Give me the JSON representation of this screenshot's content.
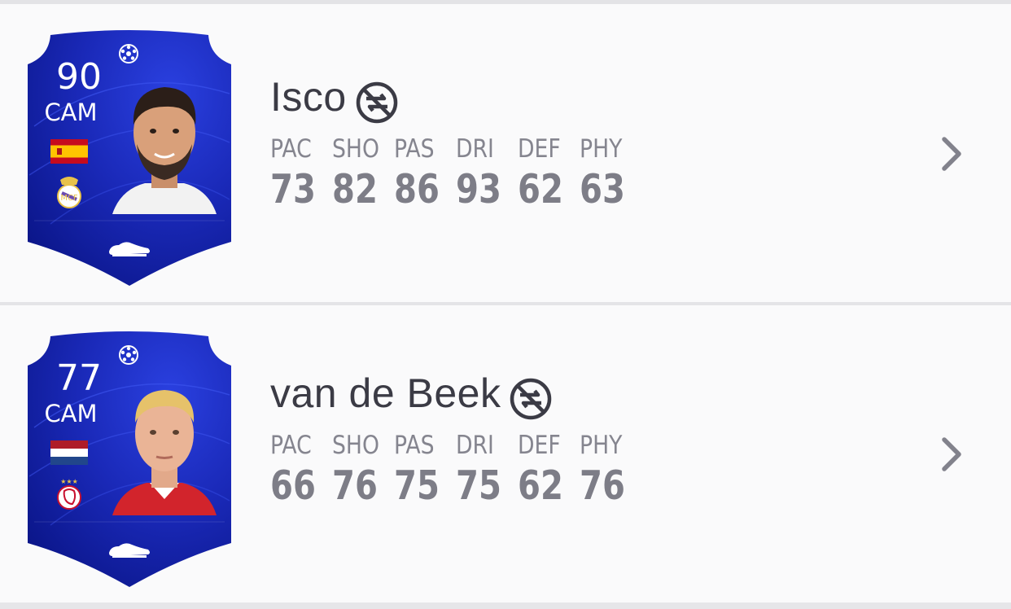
{
  "colors": {
    "card_dark": "#0a1a8c",
    "card_mid": "#1e2fc8",
    "text_dark": "#3b3b45",
    "text_muted": "#85858f",
    "chevron": "#82828c"
  },
  "stat_labels": [
    "PAC",
    "SHO",
    "PAS",
    "DRI",
    "DEF",
    "PHY"
  ],
  "players": [
    {
      "name": "Isco",
      "rating": "90",
      "position": "CAM",
      "nation_flag": "spain-flag-icon",
      "club_badge": "real-madrid-badge-icon",
      "untradeable_icon": "untradeable-icon",
      "stats": [
        {
          "label": "PAC",
          "value": "73"
        },
        {
          "label": "SHO",
          "value": "82"
        },
        {
          "label": "PAS",
          "value": "86"
        },
        {
          "label": "DRI",
          "value": "93"
        },
        {
          "label": "DEF",
          "value": "62"
        },
        {
          "label": "PHY",
          "value": "63"
        }
      ]
    },
    {
      "name": "van de Beek",
      "rating": "77",
      "position": "CAM",
      "nation_flag": "netherlands-flag-icon",
      "club_badge": "ajax-badge-icon",
      "untradeable_icon": "untradeable-icon",
      "stats": [
        {
          "label": "PAC",
          "value": "66"
        },
        {
          "label": "SHO",
          "value": "76"
        },
        {
          "label": "PAS",
          "value": "75"
        },
        {
          "label": "DRI",
          "value": "75"
        },
        {
          "label": "DEF",
          "value": "62"
        },
        {
          "label": "PHY",
          "value": "76"
        }
      ]
    }
  ]
}
